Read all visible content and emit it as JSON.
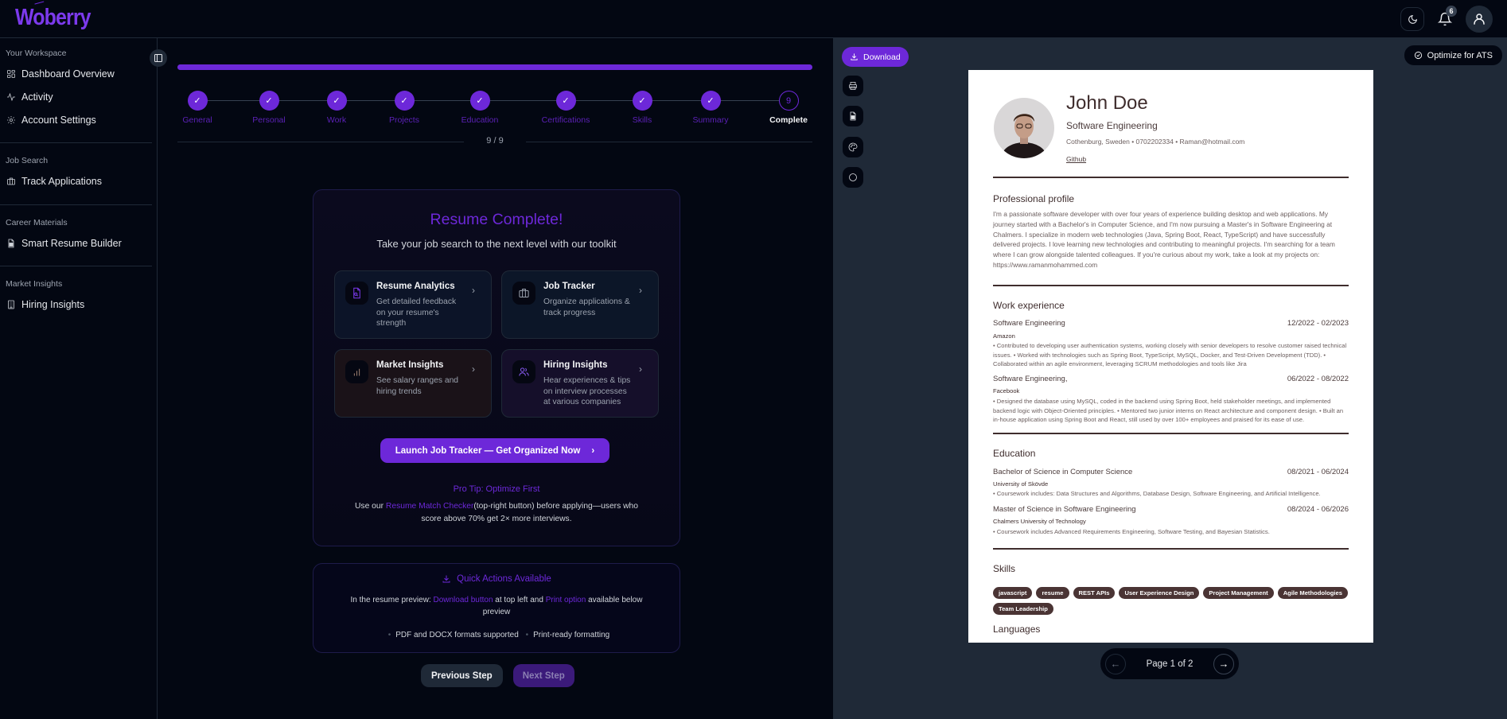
{
  "app": {
    "name": "Woberry"
  },
  "header": {
    "notifications_count": "6"
  },
  "sidebar": {
    "sections": [
      {
        "title": "Your Workspace",
        "items": [
          {
            "label": "Dashboard Overview",
            "icon": "dashboard-icon"
          },
          {
            "label": "Activity",
            "icon": "activity-icon"
          },
          {
            "label": "Account Settings",
            "icon": "gear-icon"
          }
        ]
      },
      {
        "title": "Job Search",
        "items": [
          {
            "label": "Track Applications",
            "icon": "briefcase-icon"
          }
        ]
      },
      {
        "title": "Career Materials",
        "items": [
          {
            "label": "Smart Resume Builder",
            "icon": "document-icon"
          }
        ]
      },
      {
        "title": "Market Insights",
        "items": [
          {
            "label": "Hiring Insights",
            "icon": "building-icon"
          }
        ]
      }
    ]
  },
  "wizard": {
    "progress_percent": 100,
    "steps": [
      {
        "label": "General",
        "state": "done"
      },
      {
        "label": "Personal",
        "state": "done"
      },
      {
        "label": "Work",
        "state": "done"
      },
      {
        "label": "Projects",
        "state": "done"
      },
      {
        "label": "Education",
        "state": "done"
      },
      {
        "label": "Certifications",
        "state": "done"
      },
      {
        "label": "Skills",
        "state": "done"
      },
      {
        "label": "Summary",
        "state": "done"
      },
      {
        "label": "Complete",
        "state": "current",
        "number": "9"
      }
    ],
    "counter": "9 / 9",
    "complete_card": {
      "title": "Resume Complete!",
      "subtitle": "Take your job search to the next level with our toolkit",
      "tiles": [
        {
          "title": "Resume Analytics",
          "desc": "Get detailed feedback on your resume's strength",
          "icon": "document-search-icon"
        },
        {
          "title": "Job Tracker",
          "desc": "Organize applications & track progress",
          "icon": "briefcase-icon"
        },
        {
          "title": "Market Insights",
          "desc": "See salary ranges and hiring trends",
          "icon": "bar-chart-icon"
        },
        {
          "title": "Hiring Insights",
          "desc": "Hear experiences & tips on interview processes at various companies",
          "icon": "users-icon"
        }
      ],
      "cta_label": "Launch Job Tracker — Get Organized Now",
      "tip_title": "Pro Tip: Optimize First",
      "tip_pre": "Use our ",
      "tip_link": "Resume Match Checker",
      "tip_post": "(top-right button) before applying—users who score above 70% get 2× more interviews."
    },
    "quick_actions": {
      "title": "Quick Actions Available",
      "body_pre": "In the resume preview: ",
      "link1": "Download button",
      "body_mid": " at top left and ",
      "link2": "Print option",
      "body_post": " available below preview",
      "features": [
        "PDF and DOCX formats supported",
        "Print-ready formatting"
      ]
    },
    "prev_label": "Previous Step",
    "next_label": "Next Step"
  },
  "preview": {
    "download_label": "Download",
    "ats_label": "Optimize for ATS",
    "tools": [
      "printer-icon",
      "file-icon",
      "palette-icon",
      "circle-icon"
    ],
    "pager": {
      "text": "Page 1 of 2",
      "prev": "←",
      "next": "→"
    },
    "resume": {
      "name": "John Doe",
      "title": "Software Engineering",
      "contact": "Cothenburg, Sweden • 0702202334 • Raman@hotmail.com",
      "link": "Github",
      "profile_heading": "Professional profile",
      "profile_text": "I'm a passionate software developer with over four years of experience building desktop and web applications. My journey started with a Bachelor's in Computer Science, and I'm now pursuing a Master's in Software Engineering at Chalmers. I specialize in modern web technologies (Java, Spring Boot, React, TypeScript) and have successfully delivered projects. I love learning new technologies and contributing to meaningful projects. I'm searching for a team where I can grow alongside talented colleagues. If you're curious about my work, take a look at my projects on: https://www.ramanmohammed.com",
      "work_heading": "Work experience",
      "work": [
        {
          "role": "Software Engineering",
          "dates": "12/2022 - 02/2023",
          "org": "Amazon",
          "bullets": "• Contributed to developing user authentication systems, working closely with senior developers to resolve customer raised technical issues. • Worked with technologies such as Spring Boot, TypeScript, MySQL, Docker, and Test-Driven Development (TDD). • Collaborated within an agile environment, leveraging SCRUM methodologies and tools like Jira"
        },
        {
          "role": "Software Engineering,",
          "dates": "06/2022 - 08/2022",
          "org": "Facebook",
          "bullets": "• Designed the database using MySQL, coded in the backend using Spring Boot, held stakeholder meetings, and implemented backend logic with Object-Oriented principles. • Mentored two junior interns on React architecture and component design. • Built an in-house application using Spring Boot and React, still used by over 100+ employees and praised for its ease of use."
        }
      ],
      "education_heading": "Education",
      "education": [
        {
          "degree": "Bachelor of Science in Computer Science",
          "dates": "08/2021 - 06/2024",
          "school": "University of Skövde",
          "bullets": "• Coursework includes: Data Structures and Algorithms, Database Design, Software Engineering, and Artificial Intelligence."
        },
        {
          "degree": "Master of Science in Software Engineering",
          "dates": "08/2024 - 06/2026",
          "school": "Chalmers University of Technology",
          "bullets": "• Coursework includes Advanced Requirements Engineering, Software Testing, and Bayesian Statistics."
        }
      ],
      "skills_heading": "Skills",
      "skills": [
        "javascript",
        "resume",
        "REST APIs",
        "User Experience Design",
        "Project Management",
        "Agile Methodologies",
        "Team Leadership"
      ],
      "languages_heading": "Languages"
    }
  },
  "colors": {
    "accent": "#6d28d9",
    "background": "#030712",
    "panel": "#1f2937",
    "resume_ink": "#3f2d2d"
  }
}
